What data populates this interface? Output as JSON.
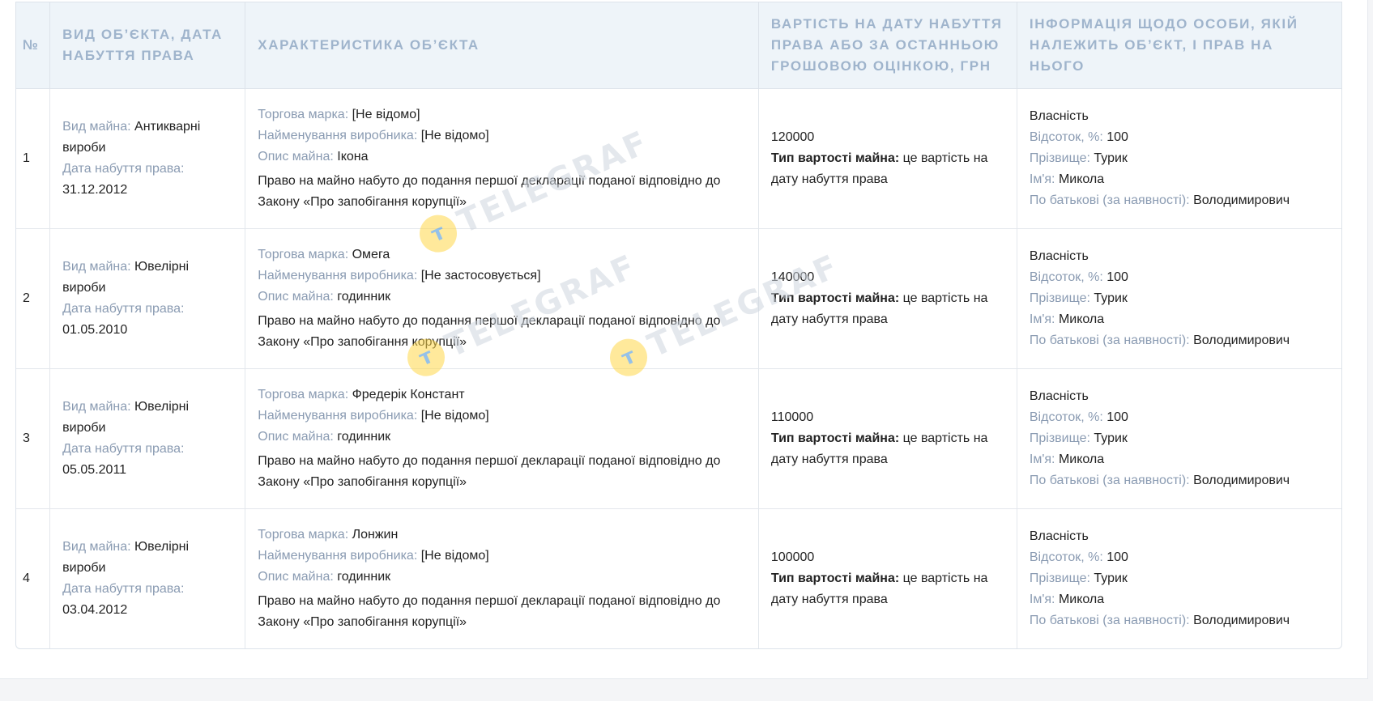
{
  "headers": {
    "num": "№",
    "type": "ВИД ОБ’ЄКТА, ДАТА НАБУТТЯ ПРАВА",
    "char": "ХАРАКТЕРИСТИКА ОБ’ЄКТА",
    "value": "ВАРТІСТЬ НА ДАТУ НАБУТТЯ ПРАВА АБО ЗА ОСТАННЬОЮ ГРОШОВОЮ ОЦІНКОЮ, ГРН",
    "owner": "ІНФОРМАЦІЯ ЩОДО ОСОБИ, ЯКІЙ НАЛЕЖИТЬ ОБ’ЄКТ, І ПРАВ НА НЬОГО"
  },
  "labels": {
    "property_type": "Вид майна:",
    "acq_date": "Дата набуття права:",
    "brand": "Торгова марка:",
    "manufacturer": "Найменування виробника:",
    "description": "Опис майна:",
    "value_type": "Тип вартості майна:",
    "percent": "Відсоток, %:",
    "surname": "Прізвище:",
    "name": "Ім'я:",
    "patronymic": "По батькові (за наявності):"
  },
  "rows": [
    {
      "num": "1",
      "property_type": "Антикварні вироби",
      "acq_date": "31.12.2012",
      "brand": "[Не відомо]",
      "manufacturer": "[Не відомо]",
      "description": "Ікона",
      "note": "Право на майно набуто до подання першої декларації поданої відповідно до Закону «Про запобігання корупції»",
      "amount": "120000",
      "value_type": "це вартість на дату набуття права",
      "right": "Власність",
      "percent": "100",
      "surname": "Турик",
      "name": "Микола",
      "patronymic": "Володимирович"
    },
    {
      "num": "2",
      "property_type": "Ювелірні вироби",
      "acq_date": "01.05.2010",
      "brand": "Омега",
      "manufacturer": "[Не застосовується]",
      "description": "годинник",
      "note": "Право на майно набуто до подання першої декларації поданої відповідно до Закону «Про запобігання корупції»",
      "amount": "140000",
      "value_type": "це вартість на дату набуття права",
      "right": "Власність",
      "percent": "100",
      "surname": "Турик",
      "name": "Микола",
      "patronymic": "Володимирович"
    },
    {
      "num": "3",
      "property_type": "Ювелірні вироби",
      "acq_date": "05.05.2011",
      "brand": "Фредерік Констант",
      "manufacturer": "[Не відомо]",
      "description": "годинник",
      "note": "Право на майно набуто до подання першої декларації поданої відповідно до Закону «Про запобігання корупції»",
      "amount": "110000",
      "value_type": "це вартість на дату набуття права",
      "right": "Власність",
      "percent": "100",
      "surname": "Турик",
      "name": "Микола",
      "patronymic": "Володимирович"
    },
    {
      "num": "4",
      "property_type": "Ювелірні вироби",
      "acq_date": "03.04.2012",
      "brand": "Лонжин",
      "manufacturer": "[Не відомо]",
      "description": "годинник",
      "note": "Право на майно набуто до подання першої декларації поданої відповідно до Закону «Про запобігання корупції»",
      "amount": "100000",
      "value_type": "це вартість на дату набуття права",
      "right": "Власність",
      "percent": "100",
      "surname": "Турик",
      "name": "Микола",
      "patronymic": "Володимирович"
    }
  ],
  "watermark": {
    "text": "TELEGRAF",
    "logo_glyph": "т",
    "logo_color": "#ffd84a",
    "text_color": "#cfd6df"
  },
  "colors": {
    "header_bg": "#eef4f9",
    "header_text": "#9fb4cc",
    "label_text": "#8a9bb2"
  }
}
